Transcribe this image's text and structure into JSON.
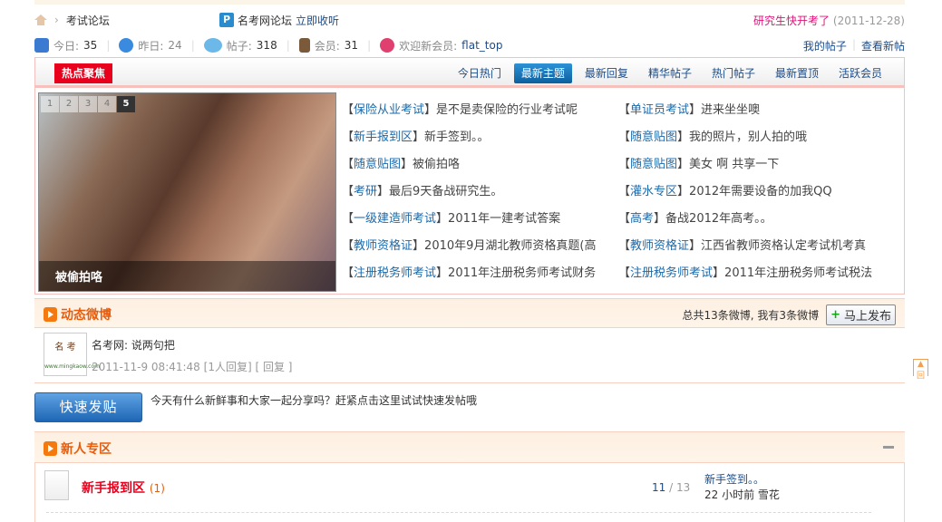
{
  "breadcrumb": {
    "current": "考试论坛"
  },
  "rss": {
    "name": "名考网论坛",
    "action": "立即收听"
  },
  "announcement": {
    "text": "研究生快开考了",
    "date": "(2011-12-28)"
  },
  "stats": [
    {
      "label": "今日:",
      "value": "35"
    },
    {
      "label": "昨日:",
      "value": "24"
    },
    {
      "label": "帖子:",
      "value": "318"
    },
    {
      "label": "会员:",
      "value": "31"
    }
  ],
  "welcome": {
    "label": "欢迎新会员:",
    "user": "flat_top"
  },
  "links": {
    "my_posts": "我的帖子",
    "new_posts": "查看新帖",
    "divider": "|"
  },
  "hot": {
    "title": "热点聚焦",
    "tabs": [
      "今日热门",
      "最新主题",
      "最新回复",
      "精华帖子",
      "热门帖子",
      "最新置顶",
      "活跃会员"
    ],
    "slides": [
      "1",
      "2",
      "3",
      "4",
      "5"
    ],
    "caption": "被偷拍咯",
    "threads": [
      {
        "forum": "保险从业考试",
        "title": "是不是卖保险的行业考试呢"
      },
      {
        "forum": "单证员考试",
        "title": "进来坐坐噢"
      },
      {
        "forum": "新手报到区",
        "title": "新手签到。。"
      },
      {
        "forum": "随意贴图",
        "title": "我的照片，别人拍的哦"
      },
      {
        "forum": "随意贴图",
        "title": "被偷拍咯"
      },
      {
        "forum": "随意贴图",
        "title": "美女 啊 共享一下"
      },
      {
        "forum": "考研",
        "title": "最后9天备战研究生。"
      },
      {
        "forum": "灌水专区",
        "title": "2012年需要设备的加我QQ"
      },
      {
        "forum": "一级建造师考试",
        "title": "2011年一建考试答案"
      },
      {
        "forum": "高考",
        "title": "备战2012年高考。。"
      },
      {
        "forum": "教师资格证",
        "title": "2010年9月湖北教师资格真题(高"
      },
      {
        "forum": "教师资格证",
        "title": "江西省教师资格认定考试机考真"
      },
      {
        "forum": "注册税务师考试",
        "title": "2011年注册税务师考试财务"
      },
      {
        "forum": "注册税务师考试",
        "title": "2011年注册税务师考试税法"
      }
    ]
  },
  "weibo": {
    "title": "动态微博",
    "summary": "总共13条微博, 我有3条微博",
    "publish": "马上发布",
    "avatar_text": "名 考",
    "avatar_sub": "www.mingkaow.com",
    "post": "名考网: 说两句把",
    "time": "2011-11-9 08:41:48",
    "replies": "[1人回复]",
    "reply": "[ 回复 ]"
  },
  "quick_post": {
    "button": "快速发贴",
    "hint": "今天有什么新鲜事和大家一起分享吗？赶紧点击这里试试快速发帖哦"
  },
  "newbie": {
    "title": "新人专区",
    "forum": "新手报到区",
    "today": "(1)",
    "threads": "11",
    "posts": "13",
    "count_sep": "/",
    "last_title": "新手签到。。",
    "last_meta": "22 小时前 雪花"
  },
  "totop": "回"
}
